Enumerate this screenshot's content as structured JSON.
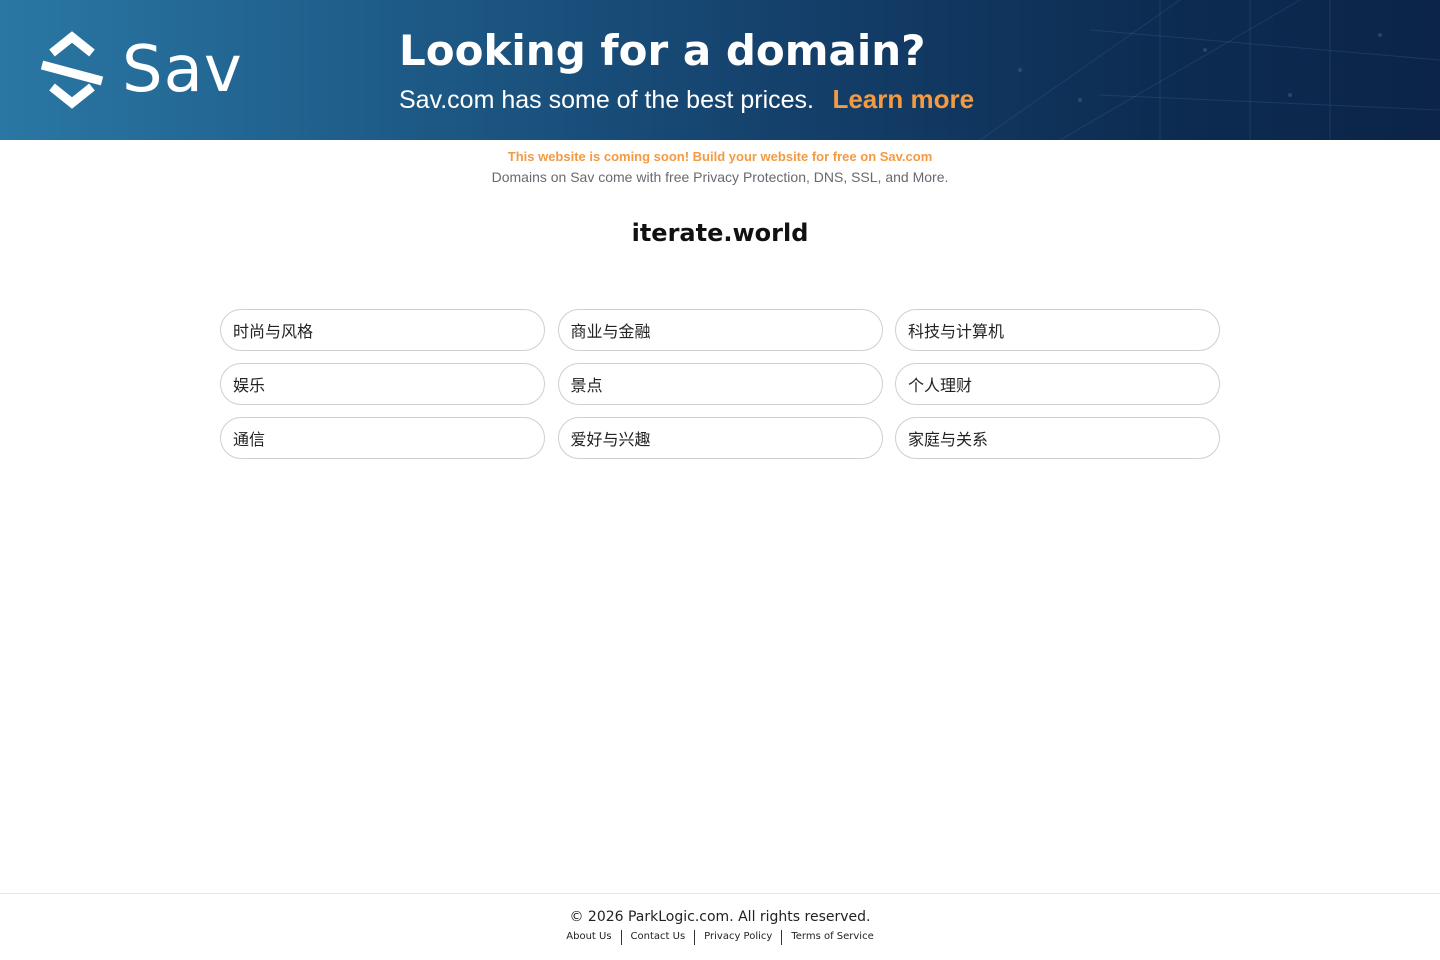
{
  "banner": {
    "logo_text": "Sav",
    "headline": "Looking for a domain?",
    "subline": "Sav.com has some of the best prices.",
    "learn_more": "Learn more",
    "colors": {
      "accent": "#f39a43",
      "bg_start": "#2a77a4",
      "bg_end": "#0b2447"
    }
  },
  "notice": {
    "line1": "This website is coming soon! Build your website for free on Sav.com",
    "line2": "Domains on Sav come with free Privacy Protection, DNS, SSL, and More."
  },
  "domain": "iterate.world",
  "categories": [
    "时尚与风格",
    "商业与金融",
    "科技与计算机",
    "娱乐",
    "景点",
    "个人理财",
    "通信",
    "爱好与兴趣",
    "家庭与关系"
  ],
  "footer": {
    "copyright": "© 2026 ParkLogic.com. All rights reserved.",
    "links": [
      "About Us",
      "Contact Us",
      "Privacy Policy",
      "Terms of Service"
    ]
  }
}
